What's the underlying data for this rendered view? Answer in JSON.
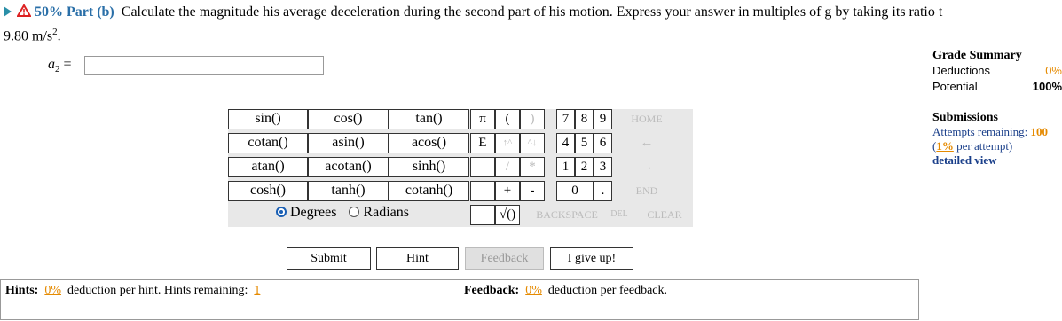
{
  "question": {
    "percent": "50%",
    "part": "Part (b)",
    "text": "Calculate the magnitude his average deceleration during the second part of his motion. Express your answer in multiples of g by taking its ratio t",
    "line2_value": "9.80 m/s",
    "line2_sup": "2",
    "line2_end": "."
  },
  "answer": {
    "label": "a",
    "sub": "2",
    "eq": "=",
    "value": ""
  },
  "keypad": {
    "functions": [
      "sin()",
      "cos()",
      "tan()",
      "cotan()",
      "asin()",
      "acos()",
      "atan()",
      "acotan()",
      "sinh()",
      "cosh()",
      "tanh()",
      "cotanh()"
    ],
    "angle_modes": [
      "Degrees",
      "Radians"
    ],
    "selected_mode": "Degrees",
    "symbols": [
      "π",
      "(",
      ")",
      "E",
      "↑^",
      "^↓",
      "/",
      "*",
      "+",
      "-",
      "√()"
    ],
    "digits": [
      "7",
      "8",
      "9",
      "4",
      "5",
      "6",
      "1",
      "2",
      "3",
      "0",
      "."
    ],
    "edit": [
      "HOME",
      "←",
      "→",
      "END",
      "BACKSPACE",
      "DEL",
      "CLEAR"
    ]
  },
  "buttons": {
    "submit": "Submit",
    "hint": "Hint",
    "feedback": "Feedback",
    "give_up": "I give up!"
  },
  "hints": {
    "label": "Hints:",
    "pct": "0%",
    "text": "deduction per hint. Hints remaining:",
    "remaining": "1"
  },
  "feedback": {
    "label": "Feedback:",
    "pct": "0%",
    "text": "deduction per feedback."
  },
  "grade_summary": {
    "title": "Grade Summary",
    "rows": [
      {
        "label": "Deductions",
        "value": "0%"
      },
      {
        "label": "Potential",
        "value": "100%"
      }
    ]
  },
  "submissions": {
    "title": "Submissions",
    "attempts_text": "Attempts remaining:",
    "attempts_value": "100",
    "per_attempt_pct": "1%",
    "per_attempt_text": "per attempt)",
    "detail_link": "detailed view"
  },
  "colors": {
    "accent": "#2a6fa8",
    "orange": "#e58a00",
    "link": "#1a3f8a"
  }
}
